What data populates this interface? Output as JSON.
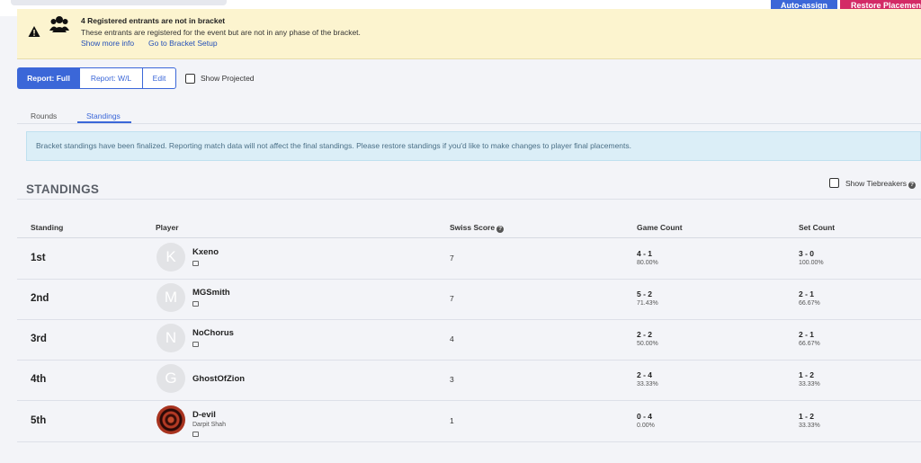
{
  "header": {
    "auto_assign_label": "Auto-assign",
    "restore_label": "Restore Placements"
  },
  "warning": {
    "title": "4 Registered entrants are not in bracket",
    "message": "These entrants are registered for the event but are not in any phase of the bracket.",
    "show_more": "Show more info",
    "go_setup": "Go to Bracket Setup"
  },
  "report": {
    "full": "Report: Full",
    "wl": "Report: W/L",
    "edit": "Edit",
    "show_projected": "Show Projected"
  },
  "tabs": [
    {
      "label": "Rounds",
      "active": false
    },
    {
      "label": "Standings",
      "active": true
    }
  ],
  "info": "Bracket standings have been finalized. Reporting match data will not affect the final standings. Please restore standings if you'd like to make changes to player final placements.",
  "standings": {
    "title": "STANDINGS",
    "show_tiebreakers": "Show Tiebreakers",
    "columns": {
      "standing": "Standing",
      "player": "Player",
      "swiss": "Swiss Score",
      "game": "Game Count",
      "set": "Set Count"
    },
    "rows": [
      {
        "placement": "1st",
        "initial": "K",
        "name": "Kxeno",
        "sub": "",
        "swiss": "7",
        "game": "4 - 1",
        "game_pct": "80.00%",
        "set": "3 - 0",
        "set_pct": "100.00%"
      },
      {
        "placement": "2nd",
        "initial": "M",
        "name": "MGSmith",
        "sub": "",
        "swiss": "7",
        "game": "5 - 2",
        "game_pct": "71.43%",
        "set": "2 - 1",
        "set_pct": "66.67%"
      },
      {
        "placement": "3rd",
        "initial": "N",
        "name": "NoChorus",
        "sub": "",
        "swiss": "4",
        "game": "2 - 2",
        "game_pct": "50.00%",
        "set": "2 - 1",
        "set_pct": "66.67%"
      },
      {
        "placement": "4th",
        "initial": "G",
        "name": "GhostOfZion",
        "sub": "",
        "swiss": "3",
        "game": "2 - 4",
        "game_pct": "33.33%",
        "set": "1 - 2",
        "set_pct": "33.33%"
      },
      {
        "placement": "5th",
        "initial": "",
        "name": "D-evil",
        "sub": "Darpit Shah",
        "swiss": "1",
        "game": "0 - 4",
        "game_pct": "0.00%",
        "set": "1 - 2",
        "set_pct": "33.33%"
      }
    ]
  },
  "colors": {
    "primary": "#3b67d8",
    "danger": "#d32a66",
    "warning_bg": "#fcf4cf",
    "info_bg": "#dbeef7"
  }
}
